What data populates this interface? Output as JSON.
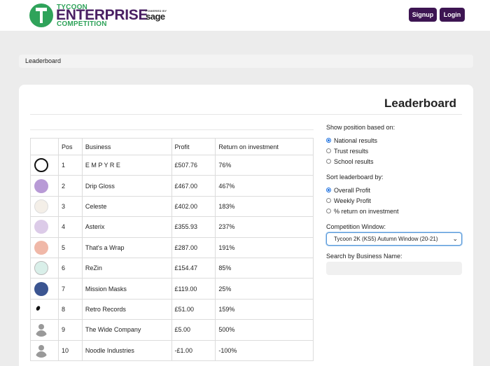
{
  "header": {
    "brand_top": "TYCOON",
    "brand_main": "ENTERPRISE",
    "brand_bottom": "COMPETITION",
    "powered_by": "POWERED BY",
    "sponsor": "sage",
    "signup_label": "Signup",
    "login_label": "Login",
    "colors": {
      "brand_purple": "#4a2063",
      "brand_green": "#2fa35a",
      "button": "#3d1552"
    }
  },
  "breadcrumb": {
    "label": "Leaderboard"
  },
  "page": {
    "title": "Leaderboard"
  },
  "table": {
    "headers": {
      "logo": "",
      "pos": "Pos",
      "business": "Business",
      "profit": "Profit",
      "roi": "Return on investment"
    },
    "rows": [
      {
        "avatar": "empyre-logo",
        "pos": "1",
        "business": "E M P Y R E",
        "profit": "£507.76",
        "roi": "76%"
      },
      {
        "avatar": "drip-gloss-logo",
        "pos": "2",
        "business": "Drip Gloss",
        "profit": "£467.00",
        "roi": "467%"
      },
      {
        "avatar": "celeste-logo",
        "pos": "3",
        "business": "Celeste",
        "profit": "£402.00",
        "roi": "183%"
      },
      {
        "avatar": "asterix-logo",
        "pos": "4",
        "business": "Asterix",
        "profit": "£355.93",
        "roi": "237%"
      },
      {
        "avatar": "thats-a-wrap-logo",
        "pos": "5",
        "business": "That's a Wrap",
        "profit": "£287.00",
        "roi": "191%"
      },
      {
        "avatar": "rezin-logo",
        "pos": "6",
        "business": "ReZin",
        "profit": "£154.47",
        "roi": "85%"
      },
      {
        "avatar": "mission-masks-logo",
        "pos": "7",
        "business": "Mission Masks",
        "profit": "£119.00",
        "roi": "25%"
      },
      {
        "avatar": "retro-records-logo",
        "pos": "8",
        "business": "Retro Records",
        "profit": "£51.00",
        "roi": "159%"
      },
      {
        "avatar": "default-person-icon",
        "pos": "9",
        "business": "The Wide Company",
        "profit": "£5.00",
        "roi": "500%"
      },
      {
        "avatar": "default-person-icon",
        "pos": "10",
        "business": "Noodle Industries",
        "profit": "-£1.00",
        "roi": "-100%"
      }
    ]
  },
  "filters": {
    "position_label": "Show position based on:",
    "position_options": [
      {
        "label": "National results",
        "selected": true
      },
      {
        "label": "Trust results",
        "selected": false
      },
      {
        "label": "School results",
        "selected": false
      }
    ],
    "sort_label": "Sort leaderboard by:",
    "sort_options": [
      {
        "label": "Overall Profit",
        "selected": true
      },
      {
        "label": "Weekly Profit",
        "selected": false
      },
      {
        "label": "% return on investment",
        "selected": false
      }
    ],
    "window_label": "Competition Window:",
    "window_value": "Tycoon 2K (KS5) Autumn Window (20-21)",
    "search_label": "Search by Business Name:",
    "search_value": ""
  }
}
